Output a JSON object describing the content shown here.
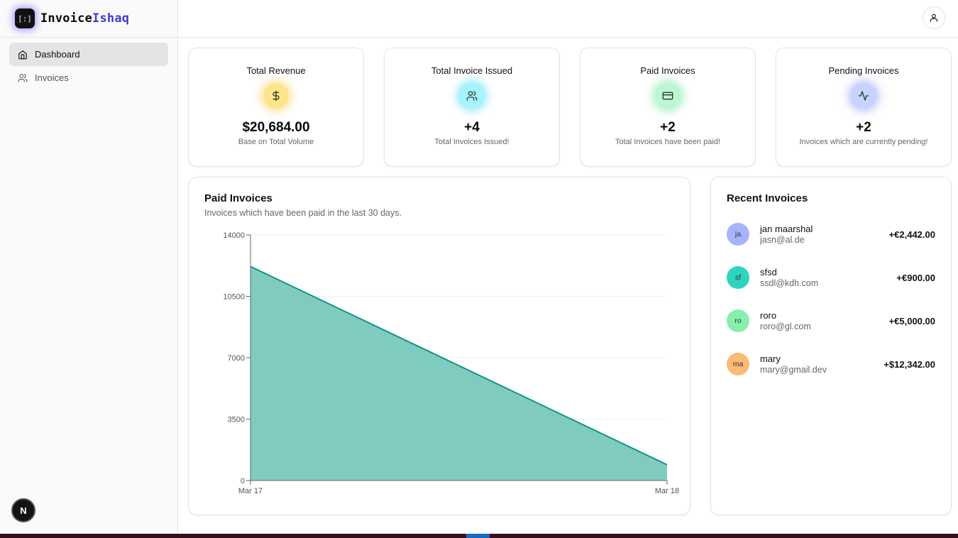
{
  "brand": {
    "logo_text": "[:]",
    "name_main": "Invoice",
    "name_accent": "Ishaq",
    "accent_color": "#3b3bd6"
  },
  "sidebar": {
    "items": [
      {
        "label": "Dashboard",
        "icon": "home-icon",
        "active": true
      },
      {
        "label": "Invoices",
        "icon": "users-icon",
        "active": false
      }
    ],
    "dev_badge": "N"
  },
  "header": {
    "user_icon": "user-icon"
  },
  "kpis": [
    {
      "title": "Total Revenue",
      "icon": "dollar-icon",
      "value": "$20,684.00",
      "sub": "Base on Total Volume",
      "color": "#fde68a"
    },
    {
      "title": "Total Invoice Issued",
      "icon": "users-icon",
      "value": "+4",
      "sub": "Total Invoices Issued!",
      "color": "#a5f3fc"
    },
    {
      "title": "Paid Invoices",
      "icon": "credit-card-icon",
      "value": "+2",
      "sub": "Total Invoices have been paid!",
      "color": "#bbf7d0"
    },
    {
      "title": "Pending Invoices",
      "icon": "activity-icon",
      "value": "+2",
      "sub": "Invoices which are currently pending!",
      "color": "#c7d2fe"
    }
  ],
  "paid_chart": {
    "title": "Paid Invoices",
    "description": "Invoices which have been paid in the last 30 days."
  },
  "chart_data": {
    "type": "area",
    "x": [
      "Mar 17",
      "Mar 18"
    ],
    "values": [
      12200,
      900
    ],
    "ylim": [
      0,
      14000
    ],
    "yticks": [
      0,
      3500,
      7000,
      10500,
      14000
    ],
    "grid": true,
    "fill_color": "#80cbc0",
    "line_color": "#0d9488"
  },
  "recent": {
    "title": "Recent Invoices",
    "items": [
      {
        "initials": "ja",
        "name": "jan maarshal",
        "email": "jasn@al.de",
        "amount": "+€2,442.00",
        "color": "#a5b4fc"
      },
      {
        "initials": "sf",
        "name": "sfsd",
        "email": "ssdl@kdh.com",
        "amount": "+€900.00",
        "color": "#2dd4bf"
      },
      {
        "initials": "ro",
        "name": "roro",
        "email": "roro@gl.com",
        "amount": "+€5,000.00",
        "color": "#86efac"
      },
      {
        "initials": "ma",
        "name": "mary",
        "email": "mary@gmail.dev",
        "amount": "+$12,342.00",
        "color": "#fdba74"
      }
    ]
  }
}
